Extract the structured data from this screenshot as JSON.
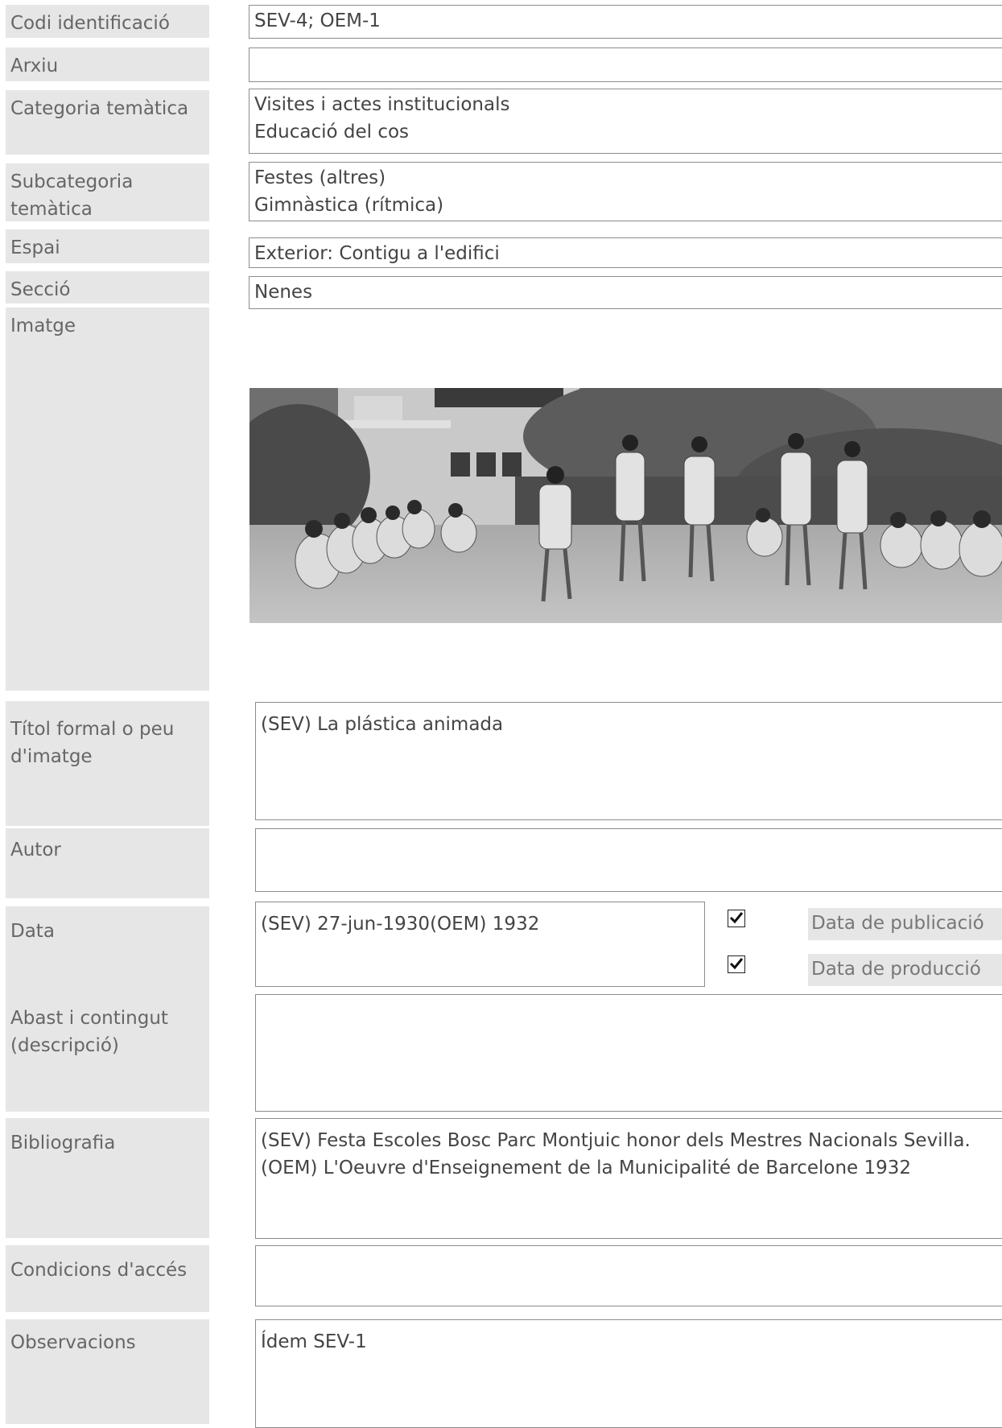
{
  "fields": {
    "codi": {
      "label": "Codi identificació",
      "value": "SEV-4; OEM-1"
    },
    "arxiu": {
      "label": "Arxiu",
      "value": ""
    },
    "categoria": {
      "label": "Categoria temàtica",
      "value": "Visites i actes institucionals\nEducació del cos"
    },
    "subcategoria": {
      "label": "Subcategoria\ntemàtica",
      "value": "Festes (altres)\nGimnàstica (rítmica)"
    },
    "espai": {
      "label": "Espai",
      "value": "Exterior: Contigu a l'edifici"
    },
    "seccio": {
      "label": "Secció",
      "value": "Nenes"
    },
    "imatge": {
      "label": "Imatge"
    },
    "titol": {
      "label": "Títol formal o peu\nd'imatge",
      "value": "(SEV) La plástica animada"
    },
    "autor": {
      "label": "Autor",
      "value": ""
    },
    "data": {
      "label": "Data",
      "value": "(SEV) 27-jun-1930(OEM) 1932",
      "check1_label": "Data de publicació",
      "check1": true,
      "check2_label": "Data de producció",
      "check2": true
    },
    "abast": {
      "label": "Abast i contingut\n(descripció)",
      "value": ""
    },
    "bibliografia": {
      "label": "Bibliografia",
      "value": "(SEV) Festa Escoles Bosc Parc Montjuic honor dels Mestres Nacionals Sevilla.\n(OEM) L'Oeuvre d'Enseignement de la Municipalité de Barcelone 1932"
    },
    "condicions": {
      "label": "Condicions d'accés",
      "value": ""
    },
    "observacions": {
      "label": "Observacions",
      "value": "Ídem SEV-1"
    }
  }
}
